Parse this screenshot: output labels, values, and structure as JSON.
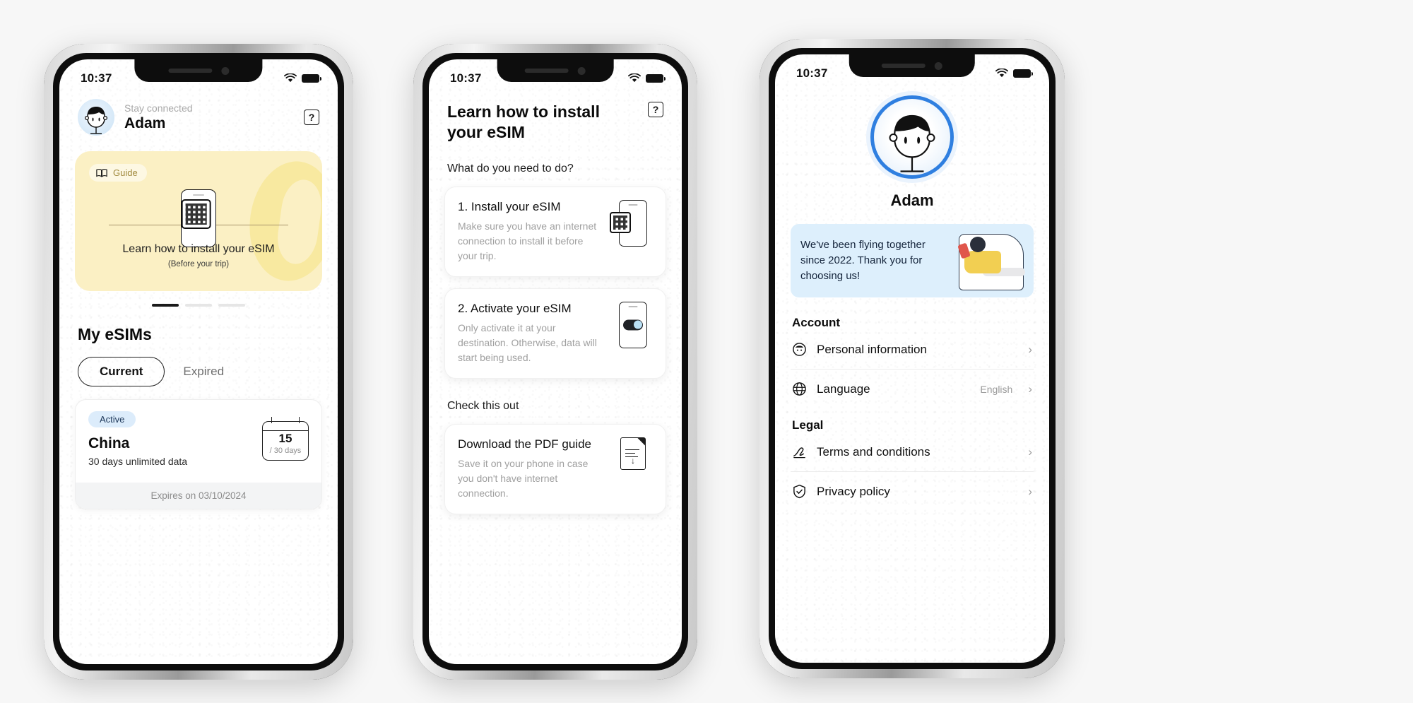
{
  "meta": {
    "accent_blue": "#2f7fe0",
    "badge_blue_bg": "#dcecfb",
    "guide_yellow": "#fbf0c4",
    "promo_blue": "#ddeffc"
  },
  "screen1": {
    "status": {
      "time": "10:37",
      "wifi_icon": "wifi-icon",
      "battery_icon": "battery-icon"
    },
    "header": {
      "greeting": "Stay connected",
      "name": "Adam",
      "help_label": "?",
      "avatar_icon": "avatar-icon"
    },
    "guide_card": {
      "badge_label": "Guide",
      "badge_icon": "book-icon",
      "title": "Learn how to install your eSIM",
      "subtitle": "(Before your trip)",
      "illustration_icon": "phone-qr-icon"
    },
    "carousel": {
      "total": 3,
      "active_index": 0
    },
    "section_title": "My eSIMs",
    "tabs": [
      {
        "label": "Current",
        "active": true
      },
      {
        "label": "Expired",
        "active": false
      }
    ],
    "esim": {
      "status_badge": "Active",
      "country": "China",
      "plan": "30 days unlimited data",
      "days_used": "15",
      "days_total": "/ 30 days",
      "footer": "Expires on 03/10/2024",
      "calendar_icon": "calendar-icon"
    }
  },
  "screen2": {
    "status": {
      "time": "10:37",
      "wifi_icon": "wifi-icon",
      "battery_icon": "battery-icon"
    },
    "title": "Learn how to install your eSIM",
    "help_label": "?",
    "question": "What do you need to do?",
    "steps": [
      {
        "title": "1. Install your eSIM",
        "desc": "Make sure you have an internet connection to install it before your trip.",
        "icon": "phone-qr-icon"
      },
      {
        "title": "2. Activate your eSIM",
        "desc": "Only activate it at your destination. Otherwise, data will start being used.",
        "icon": "phone-toggle-icon"
      }
    ],
    "check_heading": "Check this out",
    "download": {
      "title": "Download the PDF guide",
      "desc": "Save it on your phone in case you don't have internet connection.",
      "icon": "pdf-download-icon"
    }
  },
  "screen3": {
    "status": {
      "time": "10:37",
      "wifi_icon": "wifi-icon",
      "battery_icon": "battery-icon"
    },
    "profile": {
      "name": "Adam",
      "avatar_icon": "avatar-icon"
    },
    "promo": {
      "text": "We've been flying together since 2022. Thank you for choosing us!",
      "illustration_icon": "passenger-seat-icon"
    },
    "groups": [
      {
        "title": "Account",
        "rows": [
          {
            "label": "Personal information",
            "value": "",
            "icon": "person-icon",
            "chevron": "chevron-right-icon"
          },
          {
            "label": "Language",
            "value": "English",
            "icon": "globe-icon",
            "chevron": "chevron-right-icon"
          }
        ]
      },
      {
        "title": "Legal",
        "rows": [
          {
            "label": "Terms and conditions",
            "value": "",
            "icon": "signature-icon",
            "chevron": "chevron-right-icon"
          },
          {
            "label": "Privacy policy",
            "value": "",
            "icon": "shield-icon",
            "chevron": "chevron-right-icon"
          }
        ]
      }
    ]
  }
}
